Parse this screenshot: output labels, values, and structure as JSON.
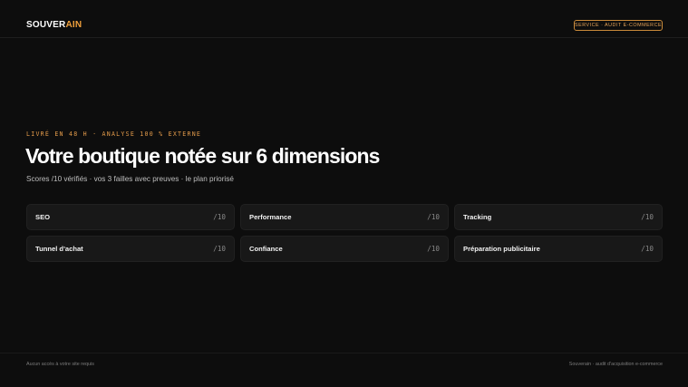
{
  "header": {
    "logo_part1": "SOUVER",
    "logo_part2": "AIN",
    "badge": "SERVICE · AUDIT E-COMMERCE"
  },
  "hero": {
    "eyebrow": "LIVRÉ EN 48 H · ANALYSE 100 % EXTERNE",
    "title": "Votre boutique notée sur 6 dimensions",
    "subtitle": "Scores /10 vérifiés · vos 3 failles avec preuves · le plan priorisé"
  },
  "dimensions": [
    {
      "label": "SEO",
      "score": "/10"
    },
    {
      "label": "Performance",
      "score": "/10"
    },
    {
      "label": "Tracking",
      "score": "/10"
    },
    {
      "label": "Tunnel d'achat",
      "score": "/10"
    },
    {
      "label": "Confiance",
      "score": "/10"
    },
    {
      "label": "Préparation publicitaire",
      "score": "/10"
    }
  ],
  "footer": {
    "left": "Aucun accès à votre site requis",
    "right": "Souverain · audit d'acquisition e-commerce"
  },
  "colors": {
    "background": "#0d0d0d",
    "accent": "#f0a03c",
    "card": "#181818"
  }
}
